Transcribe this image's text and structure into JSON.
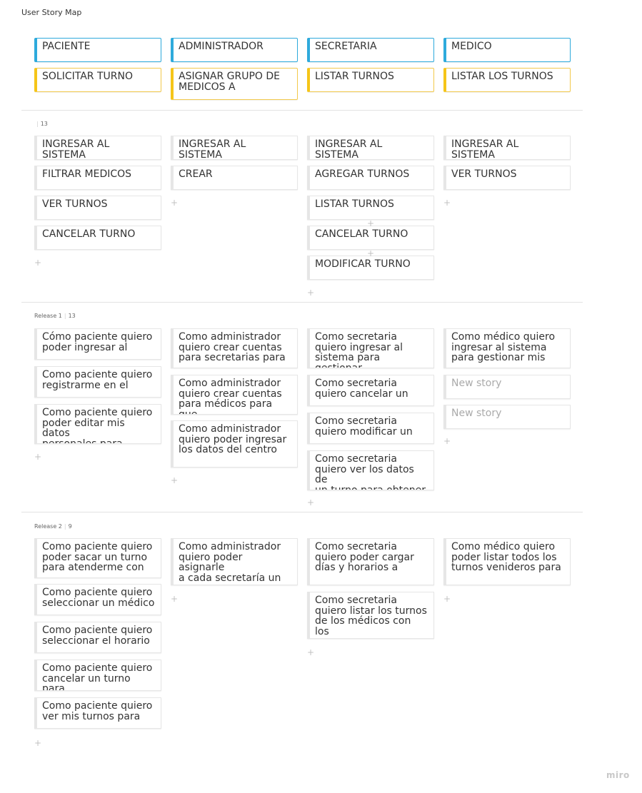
{
  "board": {
    "title": "User Story Map",
    "brand": "miro"
  },
  "colors": {
    "activity": "#2eaadc",
    "task": "#f5c518",
    "story": "#e6e6e6",
    "empty_text": "#aaaaaa"
  },
  "columns": [
    {
      "activity": "PACIENTE",
      "task": "SOLICITAR TURNO"
    },
    {
      "activity": "ADMINISTRADOR",
      "task": "ASIGNAR GRUPO DE\nMEDICOS A"
    },
    {
      "activity": "SECRETARIA",
      "task": "LISTAR TURNOS"
    },
    {
      "activity": "MEDICO",
      "task": "LISTAR LOS TURNOS"
    }
  ],
  "releases": [
    {
      "name": "",
      "count": "13",
      "lanes": [
        [
          "INGRESAR AL SISTEMA",
          "FILTRAR MEDICOS",
          "VER TURNOS",
          "CANCELAR TURNO"
        ],
        [
          "INGRESAR AL SISTEMA",
          "CREAR"
        ],
        [
          "INGRESAR AL SISTEMA",
          "AGREGAR TURNOS",
          "LISTAR TURNOS",
          "CANCELAR TURNO",
          "MODIFICAR TURNO"
        ],
        [
          "INGRESAR AL SISTEMA",
          "VER TURNOS"
        ]
      ]
    },
    {
      "name": "Release 1",
      "count": "13",
      "lanes": [
        [
          "Cómo paciente quiero\npoder ingresar al",
          "Como paciente quiero\nregistrarme en el",
          "Como paciente quiero\npoder editar mis datos\npersonales para"
        ],
        [
          "Como administrador\nquiero crear cuentas\npara secretarias para",
          "Como administrador\nquiero crear cuentas\npara médicos para que",
          "Como administrador\nquiero poder ingresar\nlos datos del centro"
        ],
        [
          "Como secretaria\nquiero ingresar al\nsistema para gestionar",
          "Como secretaria\nquiero cancelar un",
          "Como secretaria\nquiero modificar un",
          "Como secretaria\nquiero ver los datos de\nun turno para obtener"
        ],
        [
          "Como médico quiero\ningresar al sistema\npara gestionar mis",
          "New story",
          "New story"
        ]
      ]
    },
    {
      "name": "Release 2",
      "count": "9",
      "lanes": [
        [
          "Como paciente quiero\npoder sacar un turno\npara atenderme con",
          "Como paciente quiero\nseleccionar un médico",
          "Como paciente quiero\nseleccionar el horario",
          "Como paciente quiero\ncancelar un turno para",
          "Como paciente quiero\nver mis turnos para"
        ],
        [
          "Como administrador\nquiero poder asignarle\na cada secretaría un"
        ],
        [
          "Como secretaria\nquiero poder cargar\ndías y horarios a",
          "Como secretaria\nquiero listar los turnos\nde los médicos con los"
        ],
        [
          "Como médico quiero\npoder listar todos los\nturnos venideros para"
        ]
      ]
    }
  ]
}
